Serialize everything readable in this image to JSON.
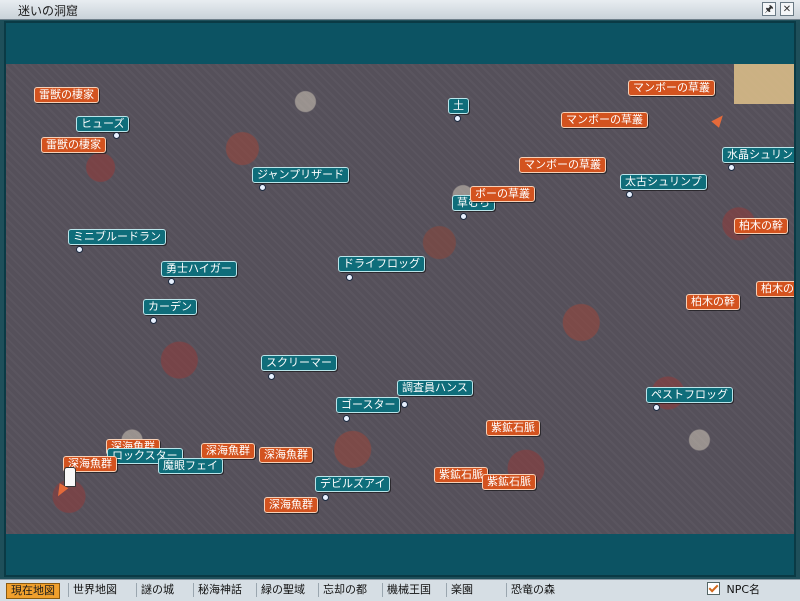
{
  "window": {
    "title": "迷いの洞窟"
  },
  "title_buttons": {
    "pin": "🖈",
    "close": "✕"
  },
  "labels": {
    "rakuju1": "雷獣の棲家",
    "rakuju2": "雷獣の棲家",
    "fuse": "ヒューズ",
    "jamp": "ジャンプリザード",
    "mini": "ミニブルードラン",
    "yushi": "勇士ハイガー",
    "kaden": "カーデン",
    "dry": "ドライフロッグ",
    "scream": "スクリーマー",
    "ghost": "ゴースター",
    "hans": "調査員ハンス",
    "pest": "ペストフロッグ",
    "tsuchi": "土",
    "kusamura": "草むら",
    "taiko": "太古シュリンプ",
    "suisho": "水晶シュリン",
    "mango1": "マンボーの草叢",
    "mango2": "マンボーの草叢",
    "mango3": "マンボーの草叢",
    "mango4": "ボーの草叢",
    "kashiwa1": "柏木の幹",
    "kashiwa2": "柏木の幹",
    "kashiwa3": "柏木の幹",
    "shien1": "紫鉱石脈",
    "shien2": "紫鉱石脈",
    "shien3": "紫鉱石脈",
    "lock": "ロックスター",
    "mabo": "魔眼フェイ",
    "deepA": "深海魚群",
    "deepB": "深海魚群",
    "deepC": "深海魚群",
    "deepD": "深海魚群",
    "deepE": "深海魚群",
    "devil": "デビルズアイ"
  },
  "tabs": [
    "現在地図",
    "世界地図",
    "謎の城",
    "秘海神話",
    "緑の聖域",
    "忘却の都",
    "機械王国",
    "楽園",
    "恐竜の森"
  ],
  "npc_toggle": {
    "label": "NPC名",
    "checked": true
  },
  "colors": {
    "npc": "#0f6d7a",
    "gate": "#d3531f",
    "active_tab": "#f0a02d"
  }
}
